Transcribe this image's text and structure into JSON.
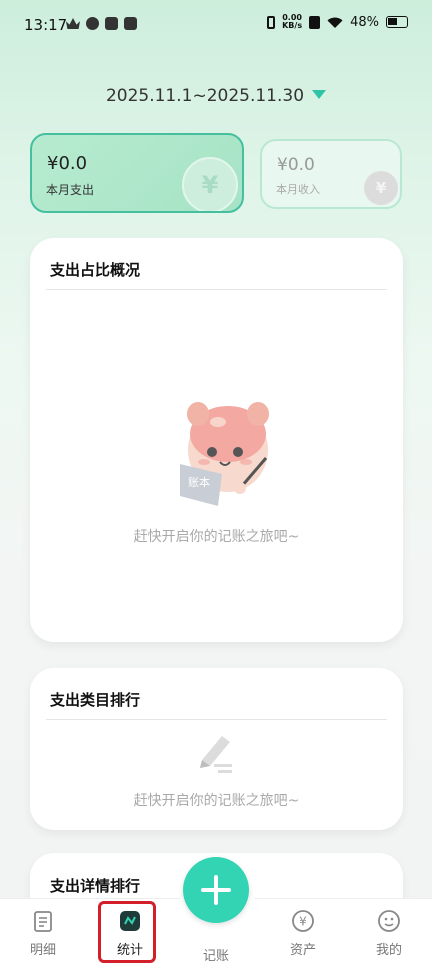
{
  "status_bar": {
    "time": "13:17",
    "net_speed_value": "0.00",
    "net_speed_unit": "KB/s",
    "battery": "48%"
  },
  "header": {
    "date_range": "2025.11.1~2025.11.30"
  },
  "summary": {
    "expense": {
      "amount": "¥0.0",
      "label": "本月支出"
    },
    "income": {
      "amount": "¥0.0",
      "label": "本月收入"
    }
  },
  "sections": {
    "ratio": {
      "title": "支出占比概况",
      "empty": "赶快开启你的记账之旅吧~"
    },
    "category": {
      "title": "支出类目排行",
      "empty": "赶快开启你的记账之旅吧~"
    },
    "detail": {
      "title": "支出详情排行"
    }
  },
  "mascot": {
    "book_text": "账本"
  },
  "nav": {
    "details": "明细",
    "stats": "统计",
    "record": "记账",
    "assets": "资产",
    "mine": "我的"
  },
  "colors": {
    "accent": "#33d4b3",
    "card_border": "#45bfa0",
    "highlight": "#d21f2a"
  }
}
